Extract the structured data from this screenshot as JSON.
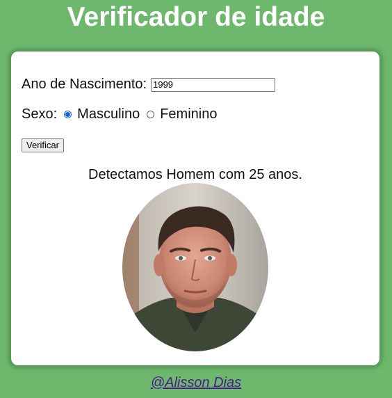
{
  "header": {
    "title": "Verificador de idade"
  },
  "form": {
    "year_label": "Ano de Nascimento:",
    "year_value": "1999",
    "sex_label": "Sexo:",
    "sex_options": [
      {
        "label": "Masculino",
        "selected": true
      },
      {
        "label": "Feminino",
        "selected": false
      }
    ],
    "submit_label": "Verificar"
  },
  "result": {
    "text": "Detectamos Homem com 25 anos.",
    "image": "man-portrait"
  },
  "footer": {
    "link": "@Alisson Dias"
  },
  "colors": {
    "background": "#6eb86e",
    "card": "#ffffff",
    "radio_accent": "#0a66d8",
    "link": "#4b1a8f"
  }
}
